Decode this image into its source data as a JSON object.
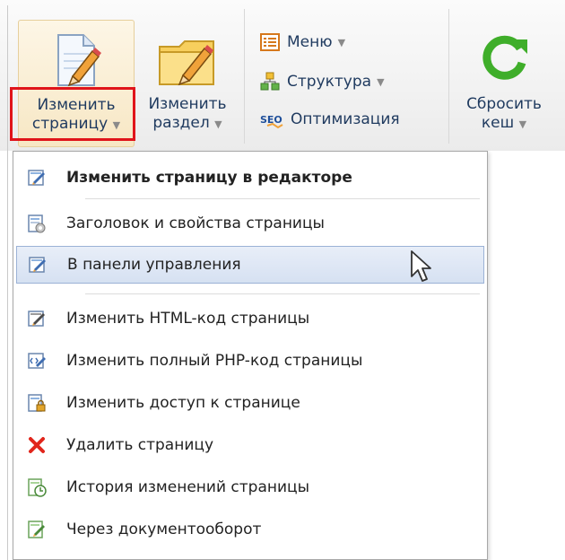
{
  "toolbar": {
    "edit_page": {
      "line1": "Изменить",
      "line2": "страницу",
      "arrow": "▼"
    },
    "edit_section": {
      "line1": "Изменить",
      "line2": "раздел",
      "arrow": "▼"
    },
    "menu_btn": {
      "label": "Меню",
      "arrow": "▼"
    },
    "structure_btn": {
      "label": "Структура",
      "arrow": "▼"
    },
    "seo_btn": {
      "label": "Оптимизация",
      "icon_text": "SEO"
    },
    "reset_cache": {
      "line1": "Сбросить",
      "line2": "кеш",
      "arrow": "▼"
    }
  },
  "dropdown": {
    "items": [
      {
        "label": "Изменить страницу в редакторе",
        "icon": "edit-page-icon"
      },
      {
        "label": "Заголовок и свойства страницы",
        "icon": "page-properties-icon"
      },
      {
        "label": "В панели управления",
        "icon": "edit-page-icon"
      },
      {
        "label": "Изменить HTML-код страницы",
        "icon": "edit-page-icon"
      },
      {
        "label": "Изменить полный PHP-код страницы",
        "icon": "php-code-icon"
      },
      {
        "label": "Изменить доступ к странице",
        "icon": "lock-page-icon"
      },
      {
        "label": "Удалить страницу",
        "icon": "delete-icon"
      },
      {
        "label": "История изменений страницы",
        "icon": "history-icon"
      },
      {
        "label": "Через документооборот",
        "icon": "workflow-icon"
      }
    ]
  },
  "colors": {
    "highlight_border": "#e0141a",
    "hover_bg": "#d6e1f2",
    "delete_red": "#e1261c",
    "refresh_green": "#3fae2a"
  }
}
